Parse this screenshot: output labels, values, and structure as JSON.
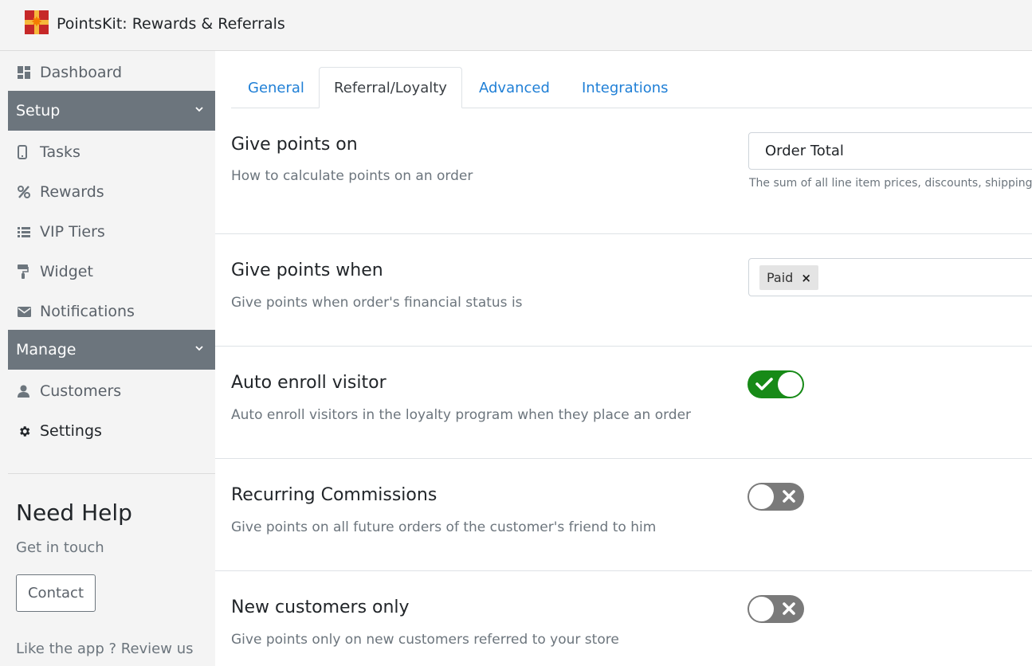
{
  "app": {
    "title": "PointsKit: Rewards & Referrals",
    "logo_icon": "gift-icon"
  },
  "sidebar": {
    "dashboard": {
      "label": "Dashboard",
      "icon": "dashboard-icon"
    },
    "setup_header": "Setup",
    "setup_items": [
      {
        "label": "Tasks",
        "icon": "mobile-icon"
      },
      {
        "label": "Rewards",
        "icon": "percent-icon"
      },
      {
        "label": "VIP Tiers",
        "icon": "list-icon"
      },
      {
        "label": "Widget",
        "icon": "paint-roller-icon"
      },
      {
        "label": "Notifications",
        "icon": "envelope-icon"
      }
    ],
    "manage_header": "Manage",
    "manage_items": [
      {
        "label": "Customers",
        "icon": "user-icon"
      },
      {
        "label": "Settings",
        "icon": "gear-icon",
        "active": true
      }
    ],
    "help": {
      "title": "Need Help",
      "subtitle": "Get in touch",
      "contact_label": "Contact",
      "review_text": "Like the app ? Review us"
    }
  },
  "tabs": [
    {
      "label": "General",
      "active": false
    },
    {
      "label": "Referral/Loyalty",
      "active": true
    },
    {
      "label": "Advanced",
      "active": false
    },
    {
      "label": "Integrations",
      "active": false
    }
  ],
  "settings": {
    "give_points_on": {
      "title": "Give points on",
      "desc": "How to calculate points on an order",
      "value": "Order Total",
      "help": "The sum of all line item prices, discounts, shipping,"
    },
    "give_points_when": {
      "title": "Give points when",
      "desc": "Give points when order's financial status is",
      "tags": [
        "Paid"
      ],
      "tag_remove": "×"
    },
    "auto_enroll": {
      "title": "Auto enroll visitor",
      "desc": "Auto enroll visitors in the loyalty program when they place an order",
      "enabled": true
    },
    "recurring": {
      "title": "Recurring Commissions",
      "desc": "Give points on all future orders of the customer's friend to him",
      "enabled": false
    },
    "new_customers": {
      "title": "New customers only",
      "desc": "Give points only on new customers referred to your store",
      "enabled": false
    }
  },
  "colors": {
    "toggle_on": "#178a17",
    "toggle_off": "#7a7a7a",
    "sidebar_header": "#6c757d",
    "link": "#1f7fd6"
  }
}
